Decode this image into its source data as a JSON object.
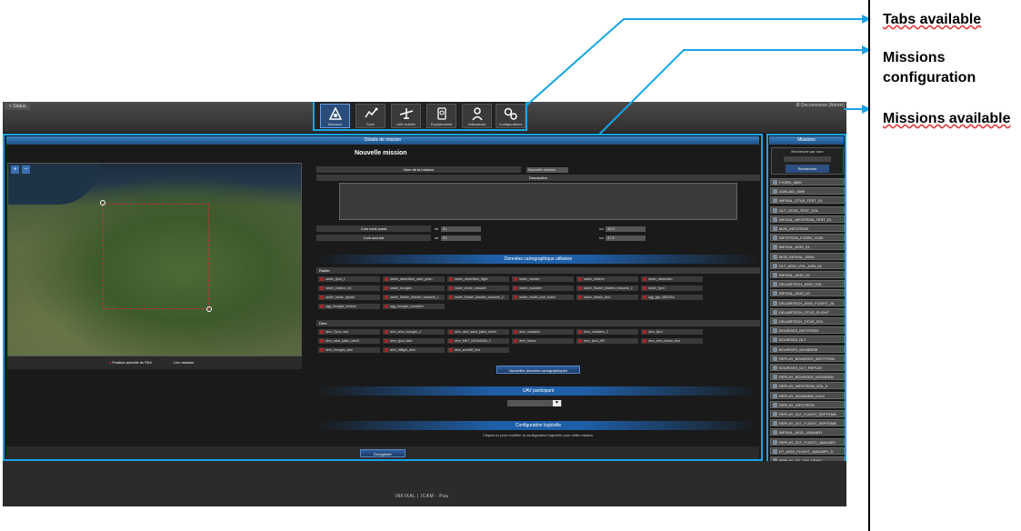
{
  "topbar": {
    "status_label": "< Status",
    "logout_label": "Ø Deconnexion (Admin)"
  },
  "tabs": [
    {
      "label": "Missions",
      "icon": "missions-icon",
      "active": true
    },
    {
      "label": "Suivi",
      "icon": "tracking-icon",
      "active": false
    },
    {
      "label": "UAV builder",
      "icon": "uav-builder-icon",
      "active": false
    },
    {
      "label": "Equipements",
      "icon": "equipment-icon",
      "active": false
    },
    {
      "label": "Utilisateurs",
      "icon": "users-icon",
      "active": false
    },
    {
      "label": "Configurations",
      "icon": "gears-icon",
      "active": false
    }
  ],
  "details": {
    "header": "Détails de mission",
    "title": "Nouvelle mission",
    "name_label": "Nom de la mission",
    "name_value": "Nouvelle mission",
    "description_label": "Description",
    "nw_label": "Coin nord-ouest",
    "se_label": "Coin sud-est",
    "lat_label": "lat",
    "lon_label": "lon",
    "nw_lat": "51",
    "nw_lon": "46.5",
    "se_lat": "53",
    "se_lon": "47.5"
  },
  "map": {
    "zoom_in": "+",
    "zoom_out": "−",
    "legend_position": "Position actuelle du PAX",
    "legend_area": "Lieu mission"
  },
  "carto": {
    "header": "Données cartographique utilisées",
    "raster_label": "Raster",
    "raster_rows": [
      [
        "raster_fjord_2",
        "raster_desertfeck_saint_julien",
        "raster_desertfeck_flight",
        "raster_mantes",
        "raster_infotron",
        "raster_alessiolen"
      ],
      [
        "raster_infotron_16",
        "raster_bourges",
        "raster_drone_oessalei",
        "raster_novadem",
        "raster_Raster_Mantes_bossaire_2",
        "raster_fjord"
      ],
      [
        "raster_raster_inpuse",
        "raster_Raster_Mantes_bossaire_1",
        "raster_Raster_Mantes_bossaire_2",
        "raster_model_club_buzen",
        "raster_dessin_tecn",
        "agg_jiga_0802016"
      ],
      [
        "agg_bourges_infotron",
        "agg_bourges_novadem"
      ]
    ],
    "dem_label": "Dem",
    "dem_rows": [
      [
        "dem_Fjord_new",
        "dem_srtm_bourges_2",
        "dem_dem_saint_julien_srtm3",
        "dem_novadem",
        "dem_novadem_2",
        "dem_fjord"
      ],
      [
        "dem_saint_julien_srtm3",
        "dem_fjord_dted",
        "dem_MNT_NOVADEM_2",
        "dem_france",
        "dem_fjord_API",
        "dem_srtm_france_test"
      ],
      [
        "dem_bourges_srtm",
        "dem_dtflight_dem",
        "dem_srtm3tif_test"
      ]
    ],
    "new_data_button": "Nouvelles données cartographiques"
  },
  "uav": {
    "header": "UAV participant"
  },
  "config": {
    "header": "Configuration logicielle",
    "hint": "Cliquez ici pour modifier la configuration logicielle pour cette mission."
  },
  "save_button": "Enregistrer",
  "missions": {
    "header": "Missions",
    "search_label": "Recherche par nom",
    "search_button": "Rechercher",
    "items": [
      "FJORD_4609",
      "ADELAID_4609",
      "INFIXAL_OTUS_TEST_01",
      "DLT_OTUS_TEST_SOL",
      "INFIXAL_INFOTRON_TEST_01",
      "MCB_INFOTRON",
      "INFOTRON_FJORD_VOID",
      "INFIXAL_ASIO_01",
      "MCB_INFIXAL_SIMU",
      "DLT_ASIO_VOL_AJIN_01",
      "INFIXAL_ASIO_02",
      "DELAIRTECH_ASIO_SOL",
      "INFIXAL_ASIO_03",
      "DELAIRTECH_ASIO_FLIGHT_JA",
      "DELAIRTECH_OTUS_FLIGHT",
      "DELAIRTECH_OTUS_SOL",
      "BOURGES_INFOTRON",
      "BOURGES_DLT",
      "BOURGES_NOVADEM",
      "REPLAY_BOURGES_INFOTRON",
      "BOURGES_DLT_REPLAY",
      "REPLAY_BOURGES_NOVADEM",
      "REPLAY_INFOTRON_VOL_9",
      "REPLAY_NOVADEM_VOL2",
      "REPLAY_INFOTRON",
      "REPLAY_DLT_FLIGHT_SEPTEMB",
      "REPLAY_DLT_FLIGHT_SEPTEMB",
      "INFIXAL_ASIO_JANUARY",
      "REPLAY_DLT_FLIGHT_JANUARY",
      "DT_ASIO_FLIGHT_JANUARY_D",
      "REPLAY_DT_JAN_DEMO"
    ],
    "new_mission": "Nouvelle mission"
  },
  "footer": {
    "brand": "INFIXAL | ICAM - Pau"
  },
  "annotations": {
    "tabs": "Tabs available",
    "config_line1": "Missions",
    "config_line2": "configuration",
    "available": "Missions available"
  },
  "colors": {
    "highlight": "#16a4e6",
    "header_blue": "#1f5fa8",
    "annotation_text": "#000000"
  }
}
